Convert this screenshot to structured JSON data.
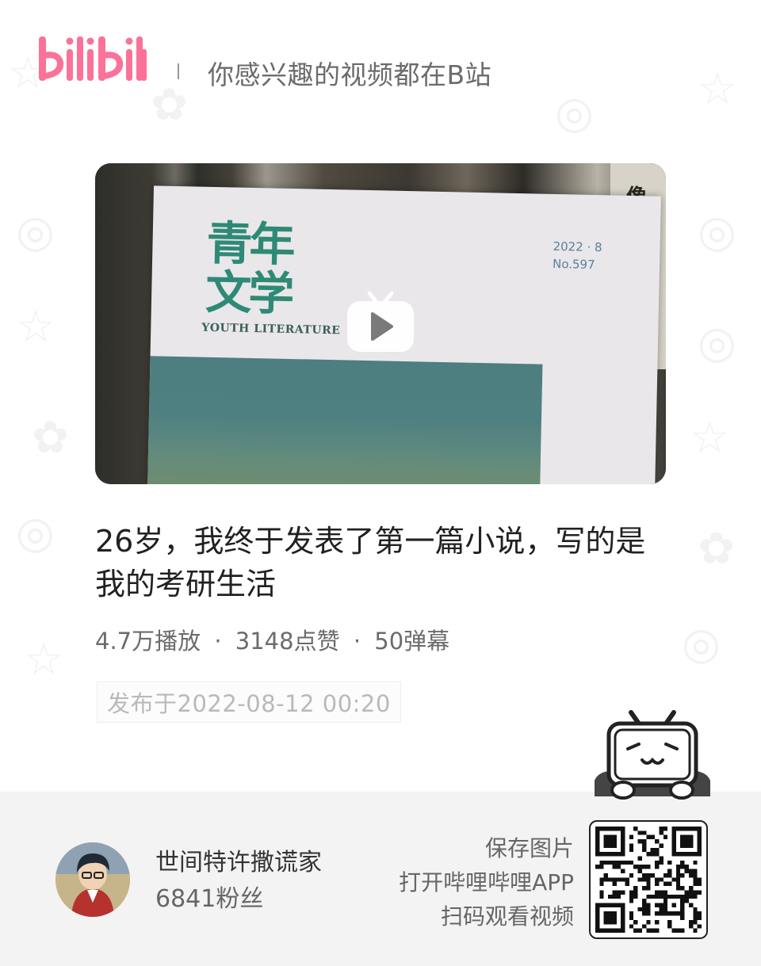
{
  "header": {
    "logo_text": "bilibili",
    "slogan": "你感兴趣的视频都在B站"
  },
  "video": {
    "cover_alt": "青年文学 2022·8 杂志封面",
    "cover_magazine_title": "青年文学",
    "cover_magazine_sub": "YOUTH LITERATURE",
    "cover_issue": "2022 · 8",
    "cover_issue_no": "No.597",
    "title": "26岁，我终于发表了第一篇小说，写的是我的考研生活",
    "plays": "4.7万播放",
    "likes": "3148点赞",
    "danmaku": "50弹幕",
    "separator": "·",
    "published": "发布于2022-08-12 00:20"
  },
  "uploader": {
    "name": "世间特许撒谎家",
    "fans": "6841粉丝"
  },
  "qr_prompt": {
    "line1": "保存图片",
    "line2": "打开哔哩哔哩APP",
    "line3": "扫码观看视频"
  },
  "colors": {
    "brand_pink": "#fb7299",
    "title_text": "#212121",
    "meta_text": "#6b6b6b",
    "footer_bg": "#f3f3f3"
  },
  "icons": [
    "bilibili-logo",
    "play-icon",
    "tv-mascot-icon",
    "qr-code"
  ]
}
